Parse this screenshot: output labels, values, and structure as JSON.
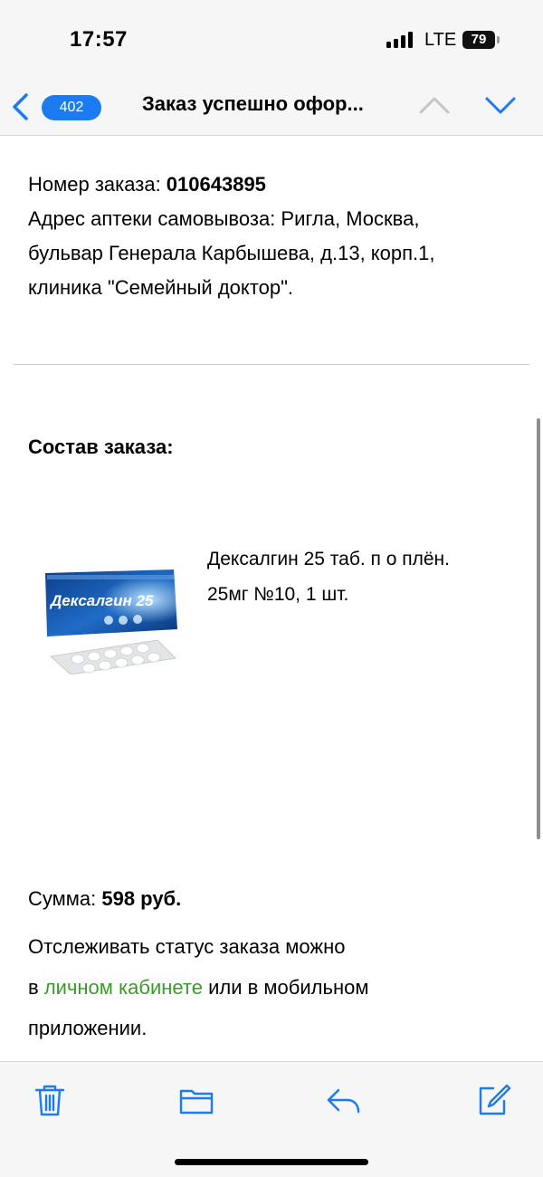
{
  "status_bar": {
    "time": "17:57",
    "network": "LTE",
    "battery": "79",
    "icons": [
      "signal-icon",
      "battery-icon"
    ]
  },
  "nav": {
    "back_badge": "402",
    "title": "Заказ успешно офор...",
    "icons": [
      "chevron-left-icon",
      "chevron-up-icon",
      "chevron-down-icon"
    ]
  },
  "email": {
    "order_number_label": "Номер заказа: ",
    "order_number": "010643895",
    "address_line_1": "Адрес аптеки самовывоза: Ригла, Москва,",
    "address_line_2": "бульвар Генерала Карбышева, д.13, корп.1,",
    "address_line_3": "клиника \"Семейный доктор\".",
    "section_title": "Состав заказа:",
    "product": {
      "name_line_1": "Дексалгин 25 таб. п о плён.",
      "name_line_2": "25мг №10, 1 шт.",
      "image_brand": "Дексалгин 25"
    },
    "sum_label": "Сумма: ",
    "sum_value": "598 руб.",
    "track_text_before": "Отслеживать статус заказа можно",
    "track_prefix": "в ",
    "track_link": "личном кабинете",
    "track_suffix": " или в мобильном",
    "track_end": "приложении."
  },
  "toolbar": {
    "icons": [
      "trash-icon",
      "folder-icon",
      "reply-icon",
      "compose-icon"
    ]
  },
  "colors": {
    "accent": "#1a7bf2",
    "link": "#3b9a2c",
    "bar_background": "#f6f6f7"
  }
}
